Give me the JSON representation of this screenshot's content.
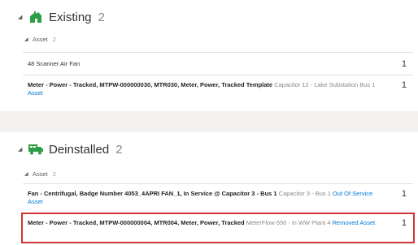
{
  "existing": {
    "title": "Existing",
    "count": "2",
    "icon": "building-icon",
    "asset_group": {
      "label": "Asset",
      "count": "2"
    },
    "rows": [
      {
        "name": "48 Scanner Air Fan",
        "detail": "",
        "status": "",
        "count": "1"
      },
      {
        "name": "Meter - Power - Tracked, MTPW-000000030, MTR030, Meter, Power, Tracked Template",
        "detail": "Capacitor 12 - Lake Substation Bus 1",
        "status": "Asset",
        "count": "1"
      }
    ]
  },
  "deinstalled": {
    "title": "Deinstalled",
    "count": "2",
    "icon": "truck-icon",
    "asset_group": {
      "label": "Asset",
      "count": "2"
    },
    "rows": [
      {
        "name": "Fan - Centrifugal, Badge Number 4053_4APRI FAN_1, In Service @ Capacitor 3 - Bus 1",
        "detail": "Capacitor 3 - Bus 1",
        "status": "Out Of Service Asset",
        "count": "1"
      },
      {
        "name": "Meter - Power - Tracked, MTPW-000000004, MTR004, Meter, Power, Tracked",
        "detail": "MeterFlow 650 - in WW Plant 4",
        "status": "Removed Asset",
        "count": "1"
      }
    ]
  },
  "colors": {
    "accent_green": "#2e9e44",
    "link": "#0078d4",
    "highlight": "#d13438"
  }
}
